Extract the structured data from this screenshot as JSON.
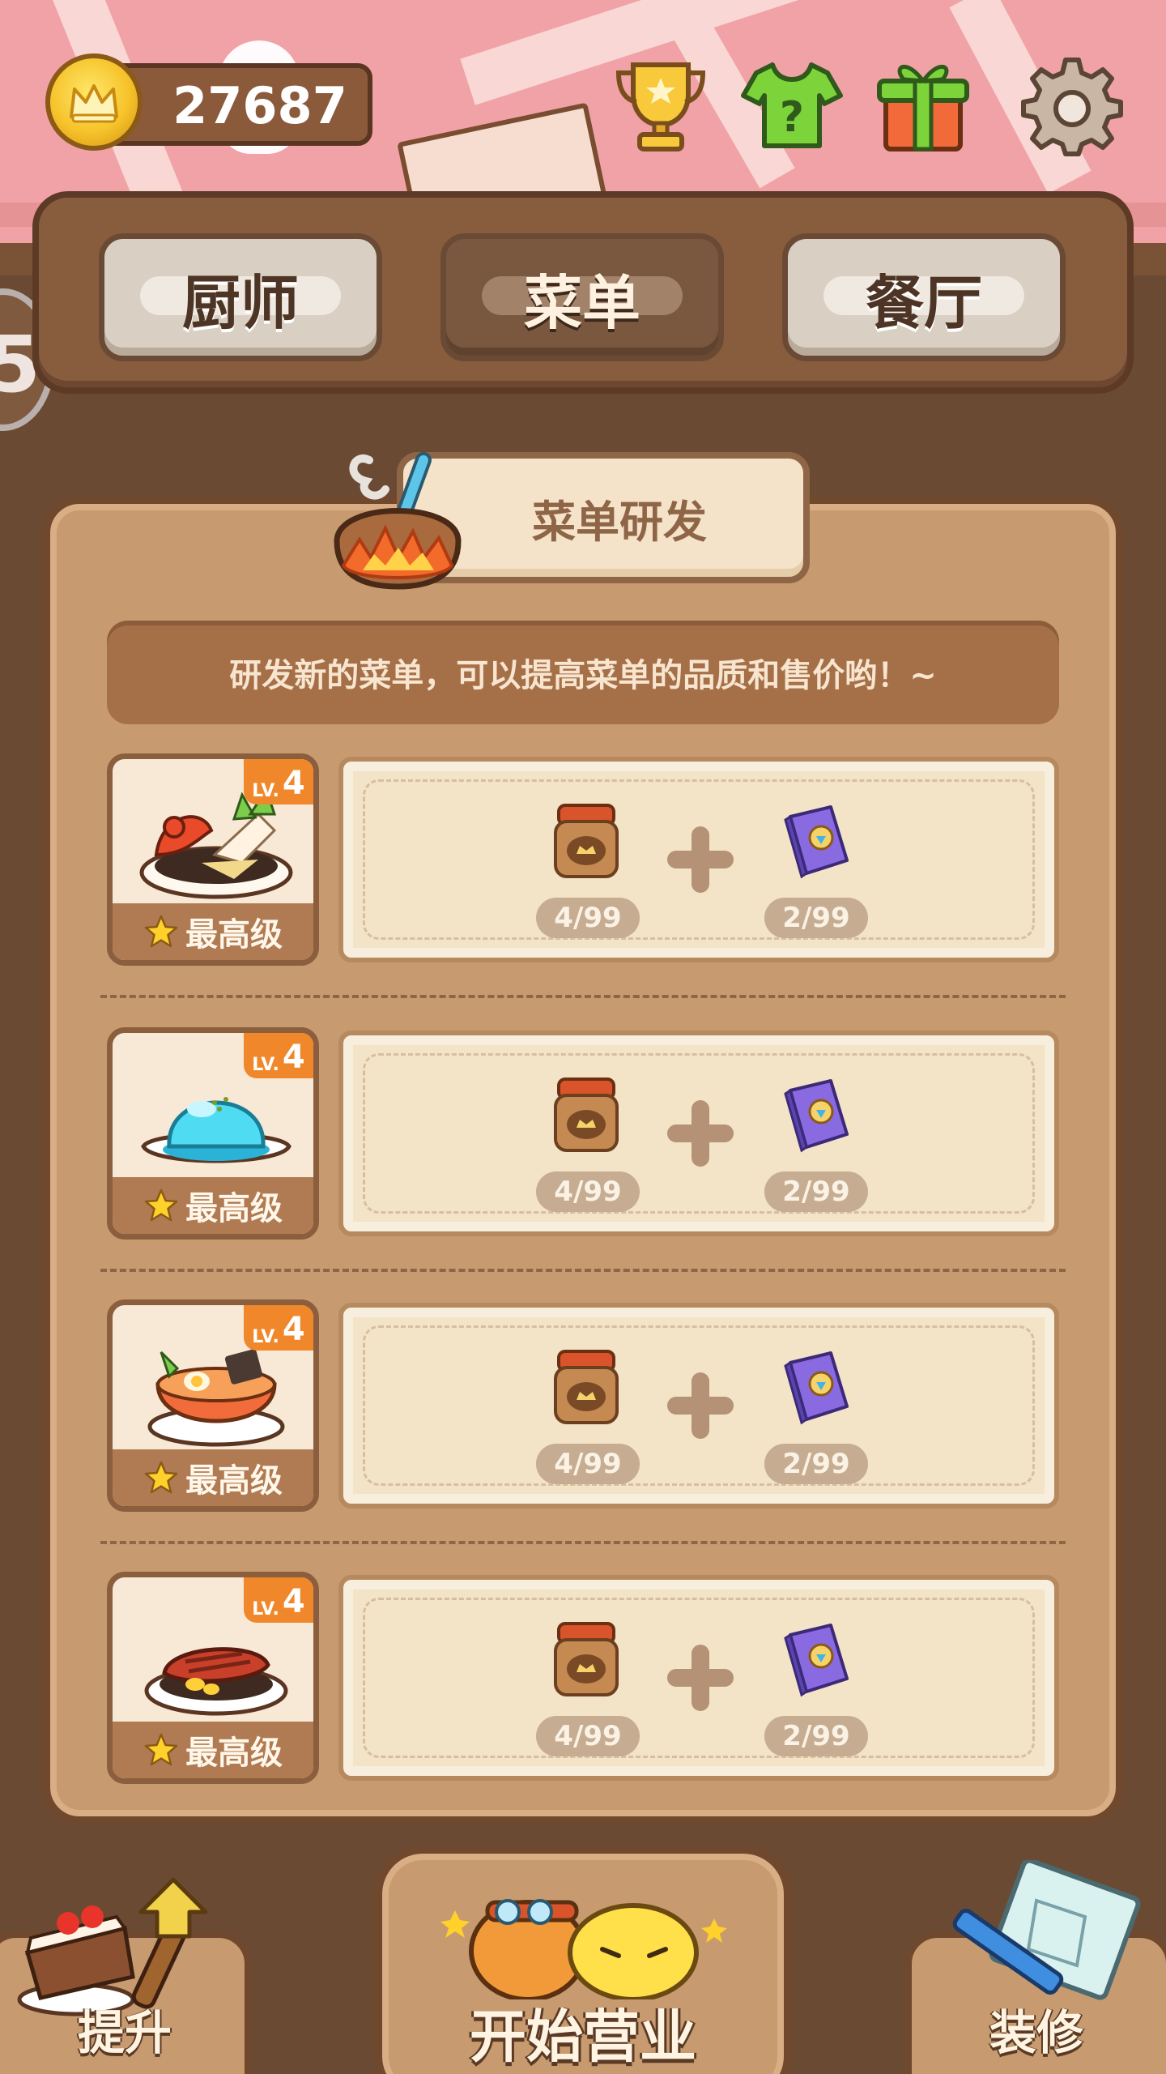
{
  "currency": {
    "coins": "27687",
    "icon": "crown-coin-icon"
  },
  "top_icons": [
    "trophy-icon",
    "mystery-shirt-icon",
    "gift-icon",
    "gear-icon"
  ],
  "tabs": [
    {
      "label": "厨师",
      "active": false
    },
    {
      "label": "菜单",
      "active": true
    },
    {
      "label": "餐厅",
      "active": false
    }
  ],
  "side_badge": "5",
  "panel": {
    "title": "菜单研发",
    "hint": "研发新的菜单，可以提高菜单的品质和售价哟！~"
  },
  "recipes": [
    {
      "dish": "seafood-platter",
      "level_text": "LV.",
      "level": "4",
      "grade": "最高级",
      "ingredients": [
        {
          "icon": "jar-icon",
          "count": "4/99"
        },
        {
          "icon": "recipe-book-icon",
          "count": "2/99"
        }
      ]
    },
    {
      "dish": "jelly-dessert",
      "level_text": "LV.",
      "level": "4",
      "grade": "最高级",
      "ingredients": [
        {
          "icon": "jar-icon",
          "count": "4/99"
        },
        {
          "icon": "recipe-book-icon",
          "count": "2/99"
        }
      ]
    },
    {
      "dish": "ramen-bowl",
      "level_text": "LV.",
      "level": "4",
      "grade": "最高级",
      "ingredients": [
        {
          "icon": "jar-icon",
          "count": "4/99"
        },
        {
          "icon": "recipe-book-icon",
          "count": "2/99"
        }
      ]
    },
    {
      "dish": "steak-plate",
      "level_text": "LV.",
      "level": "4",
      "grade": "最高级",
      "ingredients": [
        {
          "icon": "jar-icon",
          "count": "4/99"
        },
        {
          "icon": "recipe-book-icon",
          "count": "2/99"
        }
      ]
    }
  ],
  "bottom": {
    "left_label": "提升",
    "center_label": "开始营业",
    "right_label": "装修"
  },
  "colors": {
    "accent": "#f0882b",
    "wood": "#6f482e",
    "panel": "#c79a6f"
  }
}
